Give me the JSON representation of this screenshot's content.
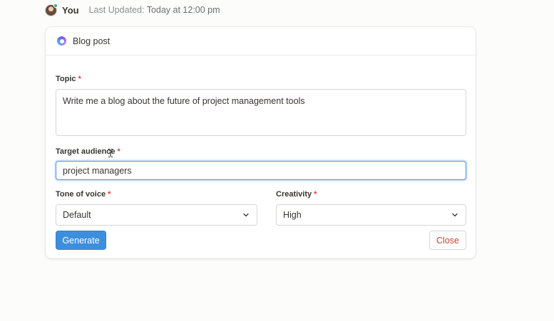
{
  "header": {
    "user_name": "You",
    "last_updated_label": "Last Updated:",
    "last_updated_value": "Today at 12:00 pm"
  },
  "card": {
    "title": "Blog post",
    "icon": "ai-sparkle-icon"
  },
  "form": {
    "topic": {
      "label": "Topic",
      "required_mark": "*",
      "value": "Write me a blog about the future of project management tools"
    },
    "target_audience": {
      "label": "Target audience",
      "required_mark": "*",
      "value": "project managers"
    },
    "tone_of_voice": {
      "label": "Tone of voice",
      "required_mark": "*",
      "selected": "Default"
    },
    "creativity": {
      "label": "Creativity",
      "required_mark": "*",
      "selected": "High"
    }
  },
  "actions": {
    "generate_label": "Generate",
    "close_label": "Close"
  },
  "colors": {
    "primary": "#3d8fde",
    "close_text": "#c8423a",
    "required": "#e03e3e",
    "focus_border": "#4a90e2"
  }
}
